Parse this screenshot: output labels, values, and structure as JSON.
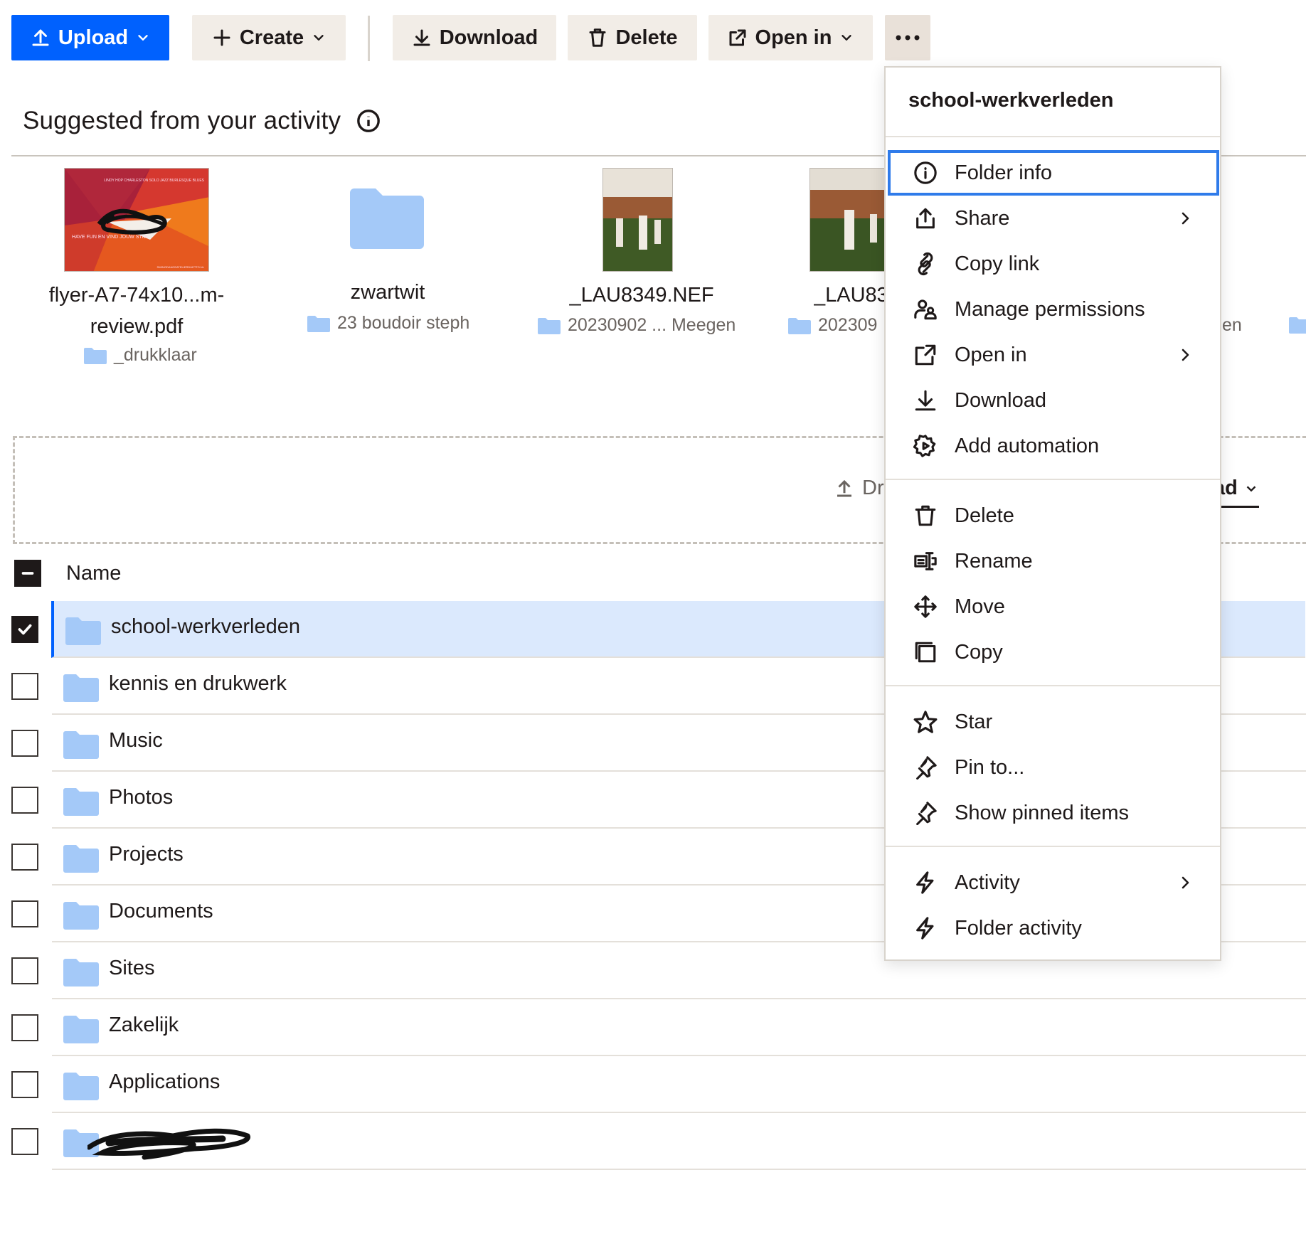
{
  "toolbar": {
    "upload": "Upload",
    "create": "Create",
    "download": "Download",
    "delete": "Delete",
    "open_in": "Open in"
  },
  "suggested": {
    "heading": "Suggested from your activity",
    "cards": [
      {
        "title_line1": "flyer-A7-74x10...m-",
        "title_line2": "review.pdf",
        "folder": "_drukklaar"
      },
      {
        "title_line1": "zwartwit",
        "title_line2": "",
        "folder": "23 boudoir steph"
      },
      {
        "title_line1": "_LAU8349.NEF",
        "title_line2": "",
        "folder": "20230902 ... Meegen"
      },
      {
        "title_line1": "_LAU83",
        "title_line2": "",
        "folder": "202309"
      }
    ],
    "partial_folder_text": "en"
  },
  "flyer_text": {
    "top": "LINDY HOP CHARLESTON SOLO JAZZ BURLESQUE BLUES",
    "left": "HAVE FUN EN VIND JOUW STIJL",
    "bottom": "SWINGDANCEATELIERDUETTO.NL"
  },
  "dropzone": {
    "text": "Dr",
    "upload_link": "ad"
  },
  "list": {
    "header_name": "Name",
    "rows": [
      {
        "name": "school-werkverleden",
        "selected": true
      },
      {
        "name": "kennis en drukwerk",
        "selected": false
      },
      {
        "name": "Music",
        "selected": false
      },
      {
        "name": "Photos",
        "selected": false
      },
      {
        "name": "Projects",
        "selected": false
      },
      {
        "name": "Documents",
        "selected": false
      },
      {
        "name": "Sites",
        "selected": false
      },
      {
        "name": "Zakelijk",
        "selected": false
      },
      {
        "name": "Applications",
        "selected": false
      },
      {
        "name": "",
        "selected": false,
        "redacted": true
      }
    ]
  },
  "context_menu": {
    "title": "school-werkverleden",
    "groups": [
      [
        {
          "label": "Folder info",
          "icon": "info-icon",
          "focused": true
        },
        {
          "label": "Share",
          "icon": "share-icon",
          "submenu": true
        },
        {
          "label": "Copy link",
          "icon": "link-icon"
        },
        {
          "label": "Manage permissions",
          "icon": "people-icon"
        },
        {
          "label": "Open in",
          "icon": "open-external-icon",
          "submenu": true
        },
        {
          "label": "Download",
          "icon": "download-icon"
        },
        {
          "label": "Add automation",
          "icon": "automation-gear-icon"
        }
      ],
      [
        {
          "label": "Delete",
          "icon": "trash-icon"
        },
        {
          "label": "Rename",
          "icon": "rename-icon"
        },
        {
          "label": "Move",
          "icon": "move-icon"
        },
        {
          "label": "Copy",
          "icon": "copy-icon"
        }
      ],
      [
        {
          "label": "Star",
          "icon": "star-icon"
        },
        {
          "label": "Pin to...",
          "icon": "pin-icon"
        },
        {
          "label": "Show pinned items",
          "icon": "pin-icon"
        }
      ],
      [
        {
          "label": "Activity",
          "icon": "lightning-icon",
          "submenu": true
        },
        {
          "label": "Folder activity",
          "icon": "lightning-icon"
        }
      ]
    ]
  },
  "colors": {
    "accent": "#0061fe",
    "toolbar_button_bg": "#f2ede7",
    "selected_row_bg": "#dbe9fd",
    "folder_blue": "#a4c9f8",
    "focus_ring": "#2f7bea"
  }
}
